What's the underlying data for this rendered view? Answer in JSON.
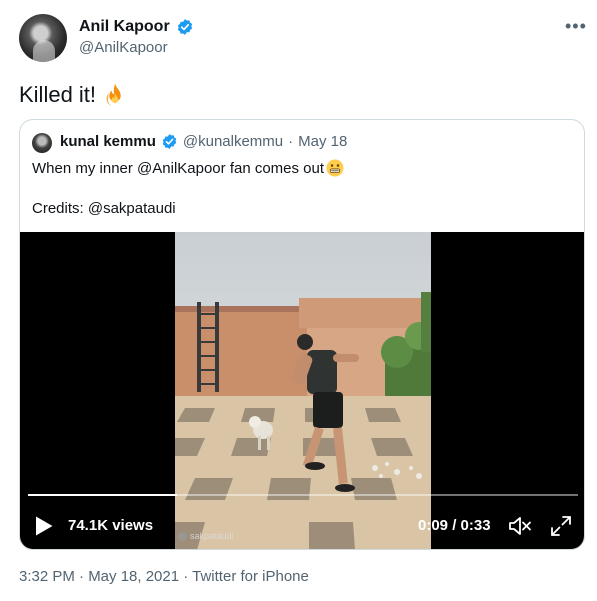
{
  "author": {
    "display_name": "Anil Kapoor",
    "handle": "@AnilKapoor",
    "verified": true
  },
  "more_icon": "ellipsis-icon",
  "tweet": {
    "text": "Killed it!",
    "emoji": "fire-emoji"
  },
  "quoted": {
    "display_name": "kunal kemmu",
    "handle": "@kunalkemmu",
    "separator": "·",
    "date": "May 18",
    "verified": true,
    "line1": "When my inner @AnilKapoor fan comes out",
    "line1_emoji": "grinning-face-emoji",
    "line2": "Credits: @sakpataudi",
    "video": {
      "views": "74.1K views",
      "time": "0:09 / 0:33",
      "progress": 0.27,
      "watermark": "sakpataudi",
      "icons": [
        "play-icon",
        "volume-icon",
        "expand-icon"
      ]
    }
  },
  "footer": {
    "timestamp": "3:32 PM · May 18, 2021 · Twitter for iPhone"
  },
  "colors": {
    "verified_blue": "#1d9bf0",
    "secondary_text": "#536471",
    "border": "#cfd9de"
  }
}
